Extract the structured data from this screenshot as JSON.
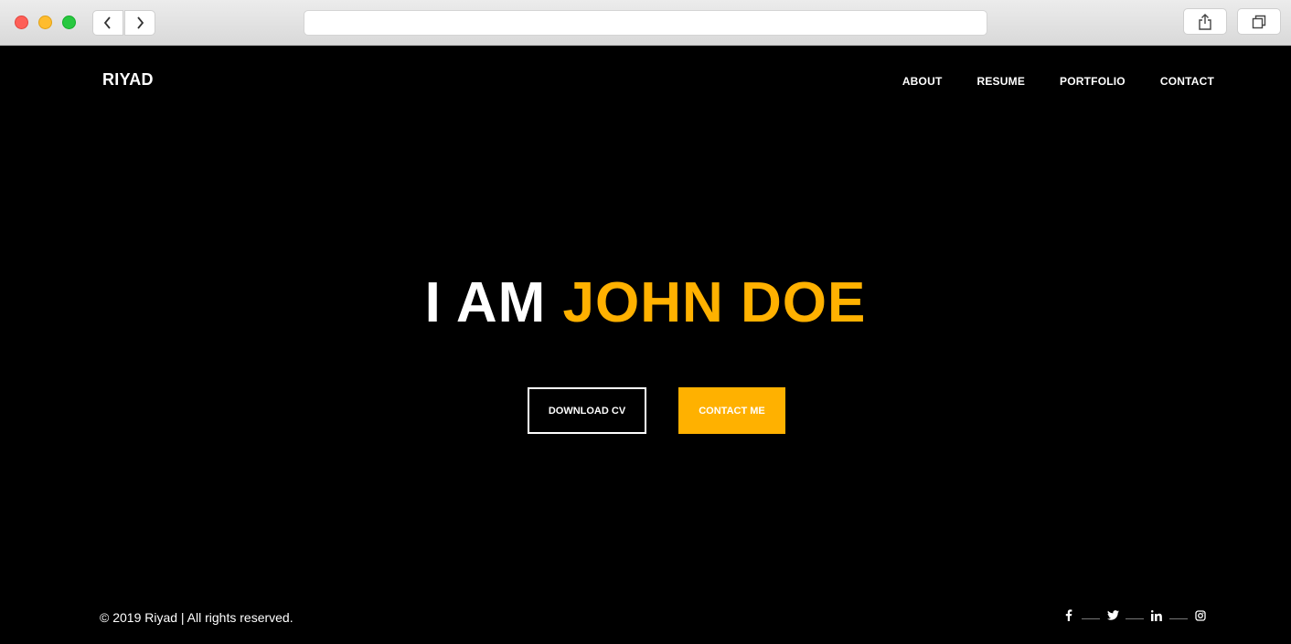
{
  "browser": {
    "url": "",
    "icons": [
      "back-icon",
      "forward-icon",
      "share-icon",
      "tabs-icon"
    ]
  },
  "header": {
    "logo": "RIYAD",
    "nav": [
      {
        "label": "ABOUT"
      },
      {
        "label": "RESUME"
      },
      {
        "label": "PORTFOLIO"
      },
      {
        "label": "CONTACT"
      }
    ]
  },
  "hero": {
    "prefix": "I AM",
    "name": "JOHN DOE",
    "download_label": "DOWNLOAD CV",
    "contact_label": "CONTACT ME"
  },
  "footer": {
    "copyright": "© 2019 Riyad | All rights reserved.",
    "social": [
      {
        "icon": "facebook-icon",
        "glyph": "f"
      },
      {
        "icon": "twitter-icon",
        "glyph": "t"
      },
      {
        "icon": "linkedin-icon",
        "glyph": "in"
      },
      {
        "icon": "instagram-icon",
        "glyph": "ig"
      }
    ]
  },
  "colors": {
    "accent": "#ffb100",
    "background": "#000000",
    "text": "#ffffff"
  }
}
